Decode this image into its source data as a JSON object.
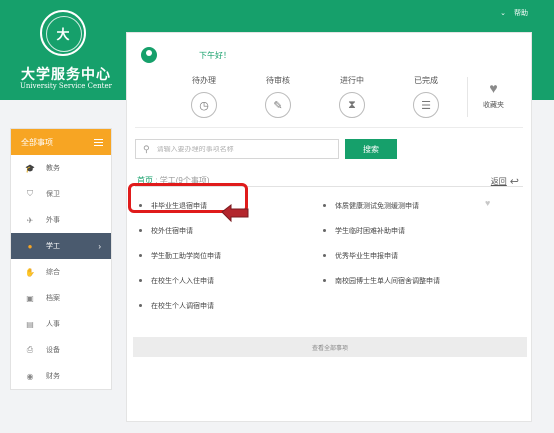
{
  "header": {
    "help_label": "帮助",
    "logo_text": "大",
    "brand_cn": "大学服务中心",
    "brand_en": "University Service Center",
    "brand_color": "#16a06b"
  },
  "sidebar": {
    "title": "全部事项",
    "accent_color": "#f7a523",
    "items": [
      {
        "label": "教务",
        "icon": "graduation-cap-icon"
      },
      {
        "label": "保卫",
        "icon": "shield-icon"
      },
      {
        "label": "外事",
        "icon": "plane-icon"
      },
      {
        "label": "学工",
        "icon": "student-icon",
        "active": true
      },
      {
        "label": "综合",
        "icon": "hand-icon"
      },
      {
        "label": "档案",
        "icon": "save-icon"
      },
      {
        "label": "人事",
        "icon": "person-card-icon"
      },
      {
        "label": "设备",
        "icon": "printer-icon"
      },
      {
        "label": "财务",
        "icon": "coin-icon"
      }
    ]
  },
  "greeting": "下午好！",
  "stats": [
    {
      "label": "待办理",
      "icon": "clock-icon"
    },
    {
      "label": "待审核",
      "icon": "edit-icon"
    },
    {
      "label": "进行中",
      "icon": "hourglass-icon"
    },
    {
      "label": "已完成",
      "icon": "document-icon"
    }
  ],
  "favorites_label": "收藏夹",
  "search": {
    "placeholder": "请输入要办理的事项名称",
    "button_label": "搜索"
  },
  "breadcrumb": {
    "home": "首页",
    "current": "学工(9个事项)"
  },
  "back_label": "返回",
  "items": [
    "非毕业生退宿申请",
    "体质健康测试免测缓测申请",
    "校外住宿申请",
    "学生临时困难补助申请",
    "学生勤工助学岗位申请",
    "优秀毕业生申报申请",
    "在校生个人入住申请",
    "南校园博士生单人间宿舍调整申请",
    "在校生个人调宿申请"
  ],
  "see_all_label": "查看全部事项"
}
